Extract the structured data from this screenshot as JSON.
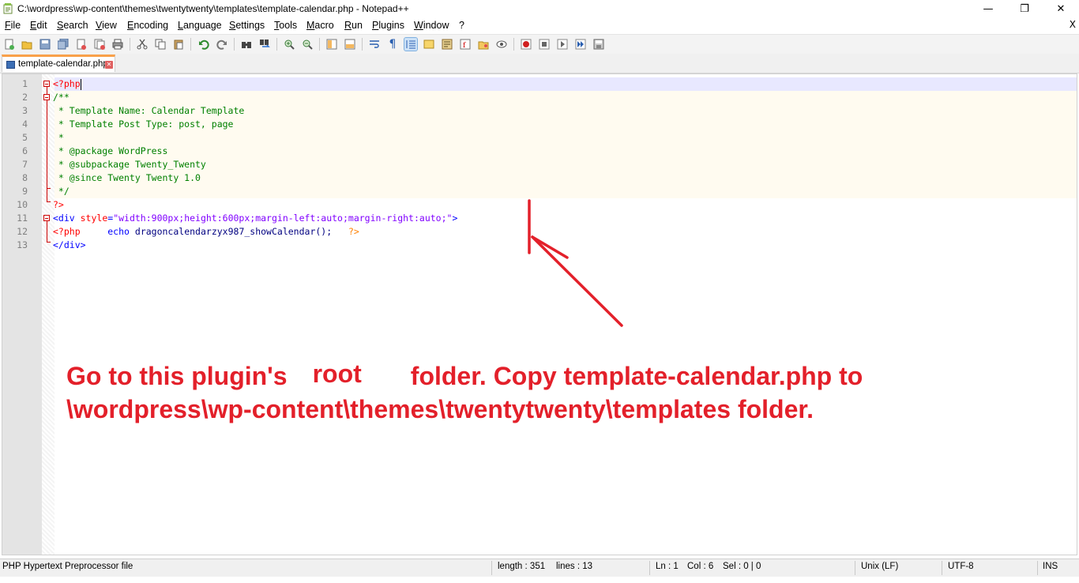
{
  "window": {
    "title": "C:\\wordpress\\wp-content\\themes\\twentytwenty\\templates\\template-calendar.php - Notepad++",
    "min": "—",
    "max": "❐",
    "close": "✕"
  },
  "menu": [
    "File",
    "Edit",
    "Search",
    "View",
    "Encoding",
    "Language",
    "Settings",
    "Tools",
    "Macro",
    "Run",
    "Plugins",
    "Window",
    "?"
  ],
  "menu_doc_close": "X",
  "tab": {
    "label": "template-calendar.php",
    "close": "✕"
  },
  "code": {
    "lines": [
      {
        "n": "1"
      },
      {
        "n": "2"
      },
      {
        "n": "3"
      },
      {
        "n": "4"
      },
      {
        "n": "5"
      },
      {
        "n": "6"
      },
      {
        "n": "7"
      },
      {
        "n": "8"
      },
      {
        "n": "9"
      },
      {
        "n": "10"
      },
      {
        "n": "11"
      },
      {
        "n": "12"
      },
      {
        "n": "13"
      }
    ],
    "l1": "<?php",
    "l2": "/**",
    "l3": " * Template Name: Calendar Template",
    "l4": " * Template Post Type: post, page",
    "l5": " *",
    "l6": " * @package WordPress",
    "l7": " * @subpackage Twenty_Twenty",
    "l8": " * @since Twenty Twenty 1.0",
    "l9": " */",
    "l10": "?>",
    "l11_tag": "<div",
    "l11_attr": " style",
    "l11_eq": "=",
    "l11_str": "\"width:900px;height:600px;margin-left:auto;margin-right:auto;\"",
    "l11_close": ">",
    "l12_open": "<?php",
    "l12_kw": "echo",
    "l12_fn": "dragoncalendarzyx987_showCalendar",
    "l12_paren": "();",
    "l12_close": "?>",
    "l13": "</div>"
  },
  "annotation": {
    "line1_a": "Go to this plugin's",
    "line1_b": "root",
    "line1_c": "folder. Copy template-calendar.php to",
    "line2": "\\wordpress\\wp-content\\themes\\twentytwenty\\templates folder.",
    "color": "#e3202a"
  },
  "status": {
    "filetype": "PHP Hypertext Preprocessor file",
    "length": "length : 351",
    "lines": "lines : 13",
    "ln": "Ln : 1",
    "col": "Col : 6",
    "sel": "Sel : 0 | 0",
    "eol": "Unix (LF)",
    "encoding": "UTF-8",
    "mode": "INS"
  }
}
